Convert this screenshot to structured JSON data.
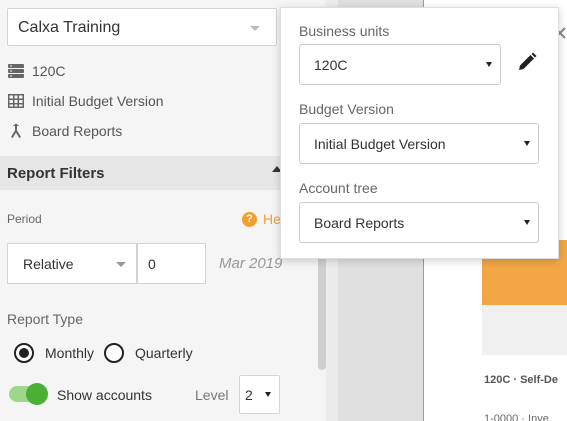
{
  "sidebar": {
    "company": "Calxa Training",
    "context": {
      "business_unit": "120C",
      "budget_version": "Initial Budget Version",
      "account_tree": "Board Reports"
    },
    "filters": {
      "title": "Report Filters",
      "period_label": "Period",
      "help_label": "He",
      "period_type": "Relative",
      "period_offset": "0",
      "period_date": "Mar 2019",
      "report_type_label": "Report Type",
      "report_types": [
        {
          "label": "Monthly",
          "selected": true
        },
        {
          "label": "Quarterly",
          "selected": false
        }
      ],
      "show_accounts_label": "Show accounts",
      "show_accounts_on": true,
      "level_label": "Level",
      "level_value": "2"
    }
  },
  "popover": {
    "business_units_label": "Business units",
    "business_units_value": "120C",
    "budget_version_label": "Budget Version",
    "budget_version_value": "Initial Budget Version",
    "account_tree_label": "Account tree",
    "account_tree_value": "Board Reports"
  },
  "document": {
    "line1": "120C · Self-De",
    "line2": "1-0000 · Inve"
  },
  "colors": {
    "accent_orange": "#f2a744",
    "help_orange": "#f0a030",
    "toggle_green": "#4caf35",
    "toggle_track": "#9fd78a"
  }
}
